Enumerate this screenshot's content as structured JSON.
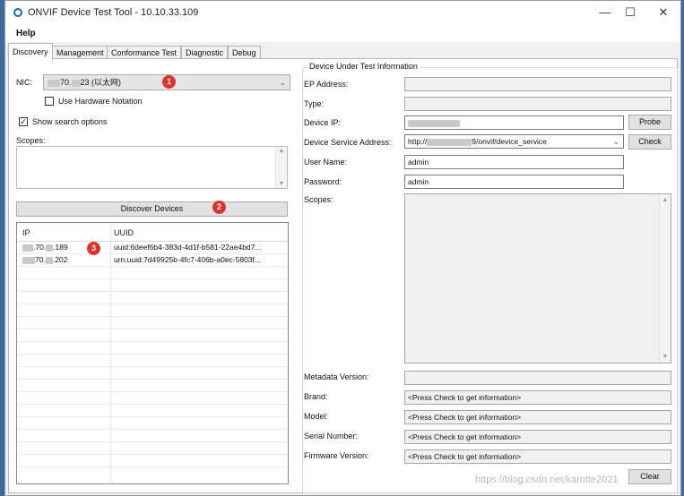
{
  "window": {
    "title": "ONVIF Device Test Tool - 10.10.33.109",
    "minimize": "—",
    "maximize": "☐",
    "close": "✕"
  },
  "menu": {
    "help": "Help"
  },
  "tabs": [
    {
      "label": "Discovery"
    },
    {
      "label": "Management"
    },
    {
      "label": "Conformance Test"
    },
    {
      "label": "Diagnostic"
    },
    {
      "label": "Debug"
    }
  ],
  "discovery": {
    "nic_label": "NIC:",
    "nic_value_mid": "70.",
    "nic_value_end": "23 (以太网)",
    "hardware_notation": {
      "label": "Use Hardware Notation",
      "checked": false
    },
    "show_search_options": {
      "label": "Show search options",
      "checked": true
    },
    "scopes_label": "Scopes:",
    "discover_button": "Discover Devices",
    "grid": {
      "headers": {
        "ip": "IP",
        "uuid": "UUID"
      },
      "rows": [
        {
          "ip_mid": ".70.",
          "ip_end": ".189",
          "uuid": "uuid:6deef6b4-383d-4d1f-b581-22ae4bd7..."
        },
        {
          "ip_mid": "70.",
          "ip_end": ".202",
          "uuid": "urn:uuid:7d49925b-4fc7-406b-a0ec-5803f..."
        }
      ]
    },
    "badges": {
      "nic": "1",
      "discover": "2",
      "grid": "3"
    }
  },
  "device": {
    "group_title": "Device Under Test Information",
    "ep_address": {
      "label": "EP Address:",
      "value": ""
    },
    "type": {
      "label": "Type:",
      "value": ""
    },
    "device_ip": {
      "label": "Device IP:",
      "value_end": ""
    },
    "probe_button": "Probe",
    "service_address": {
      "label": "Device Service Address:",
      "value_start": "http://",
      "value_end": "9/onvif/device_service"
    },
    "check_button": "Check",
    "user_name": {
      "label": "User Name:",
      "value": "admin"
    },
    "password": {
      "label": "Password:",
      "value": "admin"
    },
    "scopes_label": "Scopes:",
    "metadata_version": {
      "label": "Metadata Version:",
      "value": ""
    },
    "brand": {
      "label": "Brand:",
      "value": "<Press Check to get information>"
    },
    "model": {
      "label": "Model:",
      "value": "<Press Check to get information>"
    },
    "serial_number": {
      "label": "Serial Number:",
      "value": "<Press Check to get information>"
    },
    "firmware_version": {
      "label": "Firmware Version:",
      "value": "<Press Check to get information>"
    },
    "clear_button": "Clear"
  },
  "watermark": "https://blog.csdn.net/karotte2021",
  "icons": [
    "app-icon",
    "chevron-down-icon",
    "checkmark-icon",
    "scroll-up-arrow-icon",
    "scroll-down-arrow-icon"
  ]
}
